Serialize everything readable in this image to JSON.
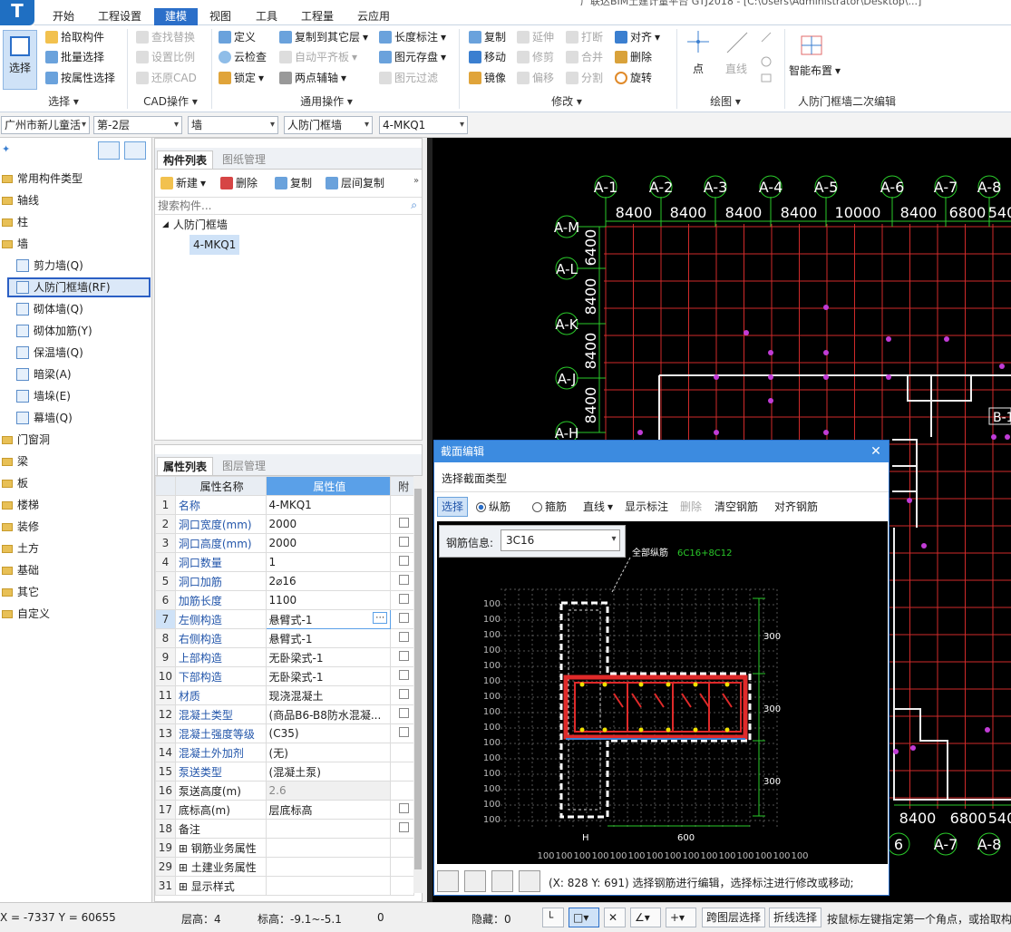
{
  "window": {
    "title": "广联达BIM土建计量平台 GTJ2018 - [C:\\Users\\Administrator\\Desktop\\...]"
  },
  "menu": [
    "开始",
    "工程设置",
    "建模",
    "视图",
    "工具",
    "工程量",
    "云应用"
  ],
  "menu_active": "建模",
  "ribbon": {
    "select": {
      "big": "选择",
      "items": [
        "拾取构件",
        "批量选择",
        "按属性选择"
      ],
      "group": "选择"
    },
    "cad": {
      "items": [
        "查找替换",
        "设置比例",
        "还原CAD"
      ],
      "group": "CAD操作"
    },
    "common": {
      "items": [
        "定义",
        "云检查",
        "锁定",
        "复制到其它层",
        "自动平齐板",
        "两点辅轴",
        "长度标注",
        "图元存盘",
        "图元过滤"
      ],
      "group": "通用操作"
    },
    "modify": {
      "items": [
        "复制",
        "移动",
        "镜像",
        "延伸",
        "修剪",
        "偏移",
        "打断",
        "合并",
        "分割",
        "对齐",
        "删除",
        "旋转"
      ],
      "group": "修改"
    },
    "draw": {
      "items": [
        "点",
        "直线"
      ],
      "group": "绘图"
    },
    "smart": {
      "label": "智能布置",
      "group": "人防门框墙二次编辑"
    }
  },
  "toolbar2": {
    "project": "广州市新儿童活",
    "floor": "第-2层",
    "type": "墙",
    "subtype": "人防门框墙",
    "component": "4-MKQ1"
  },
  "left_tree": [
    {
      "label": "常用构件类型",
      "kind": "folder"
    },
    {
      "label": "轴线",
      "kind": "folder"
    },
    {
      "label": "柱",
      "kind": "folder"
    },
    {
      "label": "墙",
      "kind": "folder"
    },
    {
      "label": "剪力墙(Q)",
      "kind": "item"
    },
    {
      "label": "人防门框墙(RF)",
      "kind": "item"
    },
    {
      "label": "砌体墙(Q)",
      "kind": "item"
    },
    {
      "label": "砌体加筋(Y)",
      "kind": "item"
    },
    {
      "label": "保温墙(Q)",
      "kind": "item"
    },
    {
      "label": "暗梁(A)",
      "kind": "item"
    },
    {
      "label": "墙垛(E)",
      "kind": "item"
    },
    {
      "label": "幕墙(Q)",
      "kind": "item"
    },
    {
      "label": "门窗洞",
      "kind": "folder"
    },
    {
      "label": "梁",
      "kind": "folder"
    },
    {
      "label": "板",
      "kind": "folder"
    },
    {
      "label": "楼梯",
      "kind": "folder"
    },
    {
      "label": "装修",
      "kind": "folder"
    },
    {
      "label": "土方",
      "kind": "folder"
    },
    {
      "label": "基础",
      "kind": "folder"
    },
    {
      "label": "其它",
      "kind": "folder"
    },
    {
      "label": "自定义",
      "kind": "folder"
    }
  ],
  "comp_panel": {
    "tabs": [
      "构件列表",
      "图纸管理"
    ],
    "actions": [
      "新建",
      "删除",
      "复制",
      "层间复制"
    ],
    "search_placeholder": "搜索构件...",
    "tree_root": "人防门框墙",
    "tree_child": "4-MKQ1"
  },
  "prop_panel": {
    "tabs": [
      "属性列表",
      "图层管理"
    ],
    "headers": [
      "属性名称",
      "属性值",
      "附"
    ],
    "rows": [
      {
        "n": "1",
        "k": "名称",
        "v": "4-MKQ1",
        "cb": false
      },
      {
        "n": "2",
        "k": "洞口宽度(mm)",
        "v": "2000",
        "cb": true
      },
      {
        "n": "3",
        "k": "洞口高度(mm)",
        "v": "2000",
        "cb": true
      },
      {
        "n": "4",
        "k": "洞口数量",
        "v": "1",
        "cb": true
      },
      {
        "n": "5",
        "k": "洞口加筋",
        "v": "2⌀16",
        "cb": true
      },
      {
        "n": "6",
        "k": "加筋长度",
        "v": "1100",
        "cb": true
      },
      {
        "n": "7",
        "k": "左侧构造",
        "v": "悬臂式-1",
        "cb": true
      },
      {
        "n": "8",
        "k": "右侧构造",
        "v": "悬臂式-1",
        "cb": true
      },
      {
        "n": "9",
        "k": "上部构造",
        "v": "无卧梁式-1",
        "cb": true
      },
      {
        "n": "10",
        "k": "下部构造",
        "v": "无卧梁式-1",
        "cb": true
      },
      {
        "n": "11",
        "k": "材质",
        "v": "现浇混凝土",
        "cb": true
      },
      {
        "n": "12",
        "k": "混凝土类型",
        "v": "(商品B6-B8防水混凝...",
        "cb": true
      },
      {
        "n": "13",
        "k": "混凝土强度等级",
        "v": "(C35)",
        "cb": true
      },
      {
        "n": "14",
        "k": "混凝土外加剂",
        "v": "(无)",
        "cb": false
      },
      {
        "n": "15",
        "k": "泵送类型",
        "v": "(混凝土泵)",
        "cb": false
      },
      {
        "n": "16",
        "k": "泵送高度(m)",
        "v": "2.6",
        "cb": false
      },
      {
        "n": "17",
        "k": "底标高(m)",
        "v": "层底标高",
        "cb": true
      },
      {
        "n": "18",
        "k": "备注",
        "v": "",
        "cb": true
      },
      {
        "n": "19",
        "k": "钢筋业务属性",
        "v": "",
        "cb": false
      },
      {
        "n": "29",
        "k": "土建业务属性",
        "v": "",
        "cb": false
      },
      {
        "n": "31",
        "k": "显示样式",
        "v": "",
        "cb": false
      }
    ]
  },
  "cad_view": {
    "axes_top": [
      "A-1",
      "A-2",
      "A-3",
      "A-4",
      "A-5",
      "A-6",
      "A-7",
      "A-8"
    ],
    "spans_top": [
      "8400",
      "8400",
      "8400",
      "8400",
      "10000",
      "8400",
      "6800",
      "540"
    ],
    "axes_left": [
      "A-M",
      "A-L",
      "A-K",
      "A-J",
      "A-H"
    ],
    "spans_left": [
      "6400",
      "8400",
      "8400",
      "8400"
    ],
    "bottom_spans": [
      "8400",
      "6800",
      "540"
    ],
    "bottom_axes": [
      "6",
      "A-7",
      "A-8"
    ],
    "right_label": "B-1"
  },
  "dialog": {
    "title": "截面编辑",
    "subtitle": "选择截面类型",
    "toolbar": {
      "select": "选择",
      "radio1": "纵筋",
      "radio2": "箍筋",
      "line": "直线",
      "show": "显示标注",
      "delete": "删除",
      "clear": "清空钢筋",
      "align": "对齐钢筋"
    },
    "rebar_label": "钢筋信息:",
    "rebar_value": "3C16",
    "annotation": "全部纵筋",
    "annotation_value": "6C16+8C12",
    "dims": [
      "100",
      "300",
      "H",
      "600"
    ],
    "status": "(X: 828 Y: 691) 选择钢筋进行编辑，选择标注进行修改或移动;"
  },
  "status": {
    "coords": "X = -7337 Y = 60655",
    "floor_h": "层高：4",
    "elev": "标高：-9.1~-5.1",
    "zero": "0",
    "hidden": "隐藏：0",
    "cross_layer": "跨图层选择",
    "polyline": "折线选择",
    "hint": "按鼠标左键指定第一个角点，或拾取构"
  }
}
